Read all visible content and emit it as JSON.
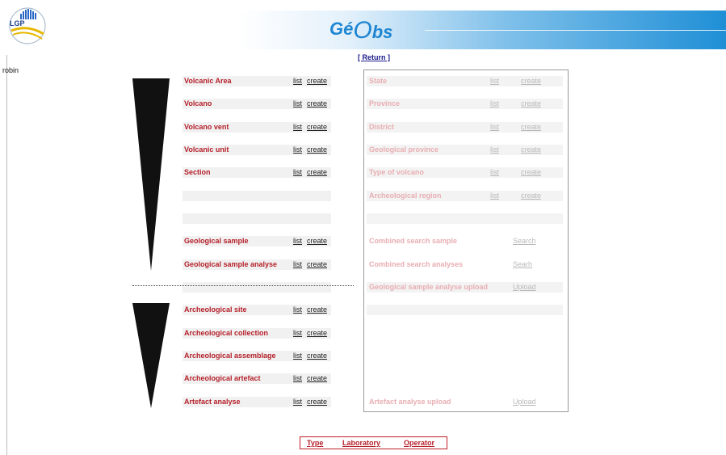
{
  "header": {
    "logo_text": "LGP",
    "brand": {
      "ge": "Gé",
      "o": "O",
      "bs": "bs"
    }
  },
  "user": {
    "name": "robin"
  },
  "nav": {
    "return_label": "[ Return ]"
  },
  "left_rows": [
    {
      "label": "Volcanic Area",
      "list": "list",
      "create": "create"
    },
    {
      "label": "Volcano",
      "list": "list",
      "create": "create"
    },
    {
      "label": "Volcano vent",
      "list": "list",
      "create": "create"
    },
    {
      "label": "Volcanic unit",
      "list": "list",
      "create": "create"
    },
    {
      "label": "Section",
      "list": "list",
      "create": "create"
    },
    {
      "label": "",
      "list": "",
      "create": ""
    },
    {
      "label": "",
      "list": "",
      "create": ""
    },
    {
      "label": "Geological sample",
      "list": "list",
      "create": "create"
    },
    {
      "label": "Geological sample analyse",
      "list": "list",
      "create": "create"
    },
    {
      "label": "",
      "list": "",
      "create": ""
    },
    {
      "label": "Archeological site",
      "list": "list",
      "create": "create"
    },
    {
      "label": "Archeological collection",
      "list": "list",
      "create": "create"
    },
    {
      "label": "Archeological assemblage",
      "list": "list",
      "create": "create"
    },
    {
      "label": "Archeological artefact",
      "list": "list",
      "create": "create"
    },
    {
      "label": "Artefact analyse",
      "list": "list",
      "create": "create"
    }
  ],
  "right_rows": [
    {
      "label": "State",
      "list": "list",
      "create": "create"
    },
    {
      "label": "Province",
      "list": "list",
      "create": "create"
    },
    {
      "label": "District",
      "list": "list",
      "create": "create"
    },
    {
      "label": "Geological province",
      "list": "list",
      "create": "create"
    },
    {
      "label": "Type of volcano",
      "list": "list",
      "create": "create"
    },
    {
      "label": "Archeological region",
      "list": "list",
      "create": "create"
    },
    {
      "label": "",
      "list": "",
      "create": ""
    },
    {
      "label": "Combined search sample",
      "action": "Search"
    },
    {
      "label": "Combined search analyses",
      "action": "Searh"
    },
    {
      "label": "Geological sample analyse upload",
      "action": "Upload"
    },
    {
      "label": "",
      "action": ""
    },
    {
      "label": "Artefact analyse upload",
      "action": "Upload"
    }
  ],
  "footer": {
    "type": "Type",
    "laboratory": "Laboratory",
    "operator": "Operator"
  },
  "colors": {
    "accent_red": "#b5202a",
    "faded_red": "#e8aeb2",
    "brand_blue": "#1f86d2"
  }
}
